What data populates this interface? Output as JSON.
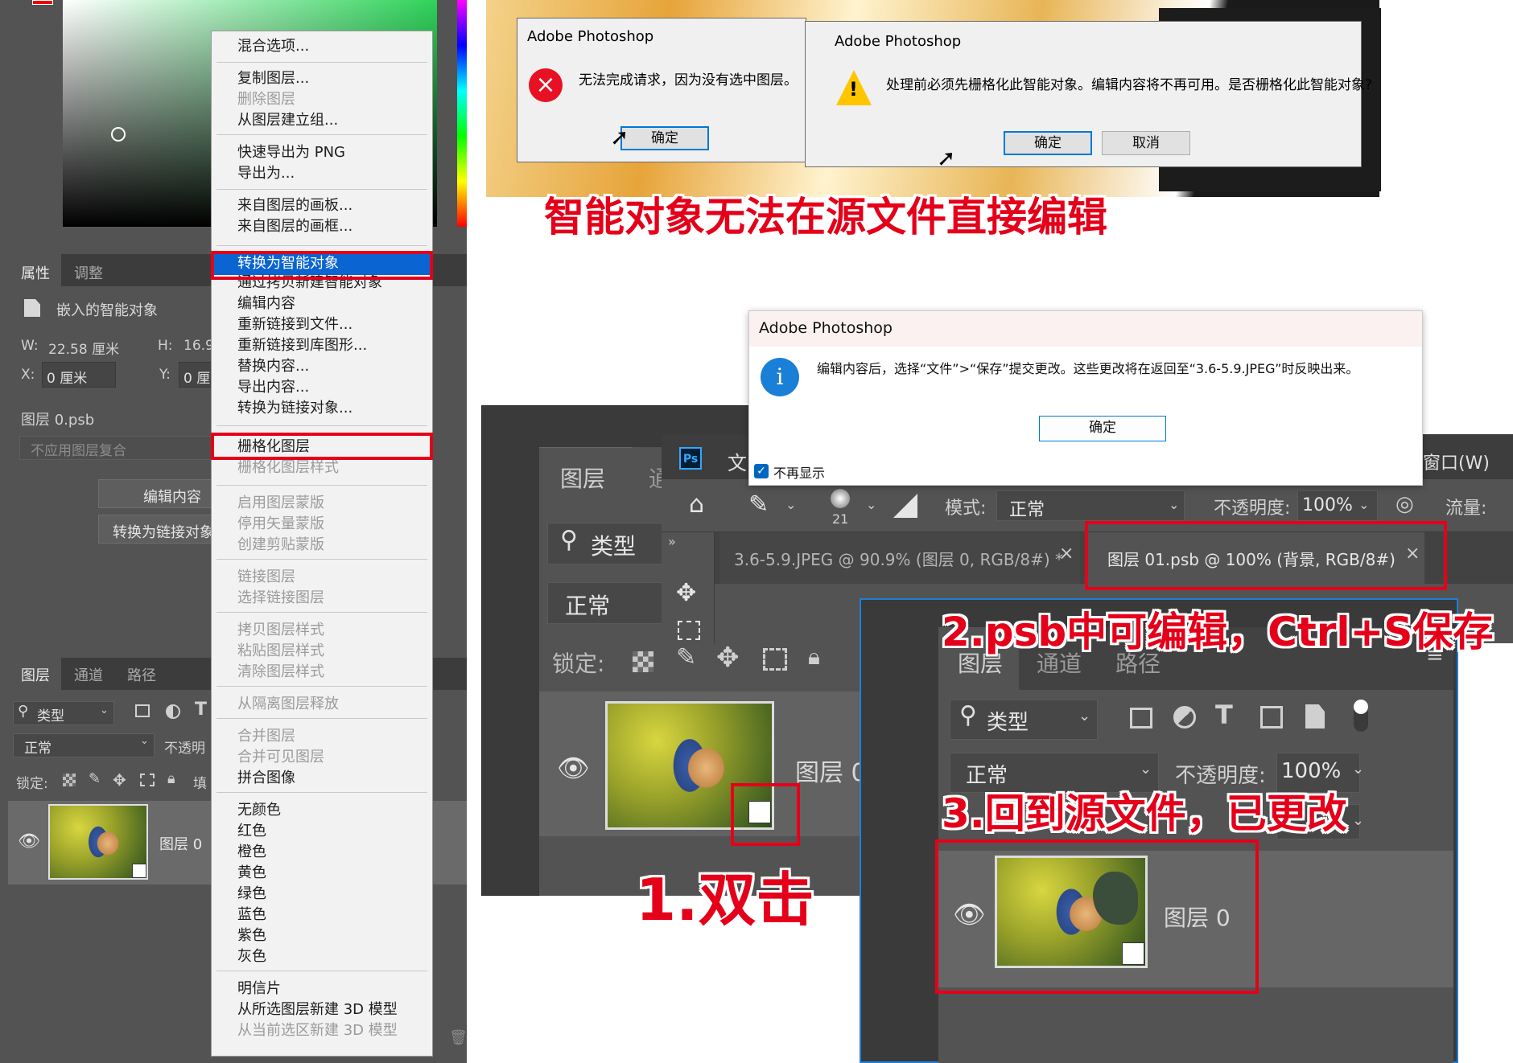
{
  "left_panel": {
    "properties_tabs": [
      "属性",
      "调整"
    ],
    "object_kind": "嵌入的智能对象",
    "w_label": "W:",
    "w_value": "22.58 厘米",
    "h_label": "H:",
    "h_value": "16.9",
    "x_label": "X:",
    "x_value": "0 厘米",
    "y_label": "Y:",
    "y_value": "0 厘",
    "file_name": "图层 0.psb",
    "layer_comp": "不应用图层复合",
    "edit_button": "编辑内容",
    "convert_button": "转换为链接对象",
    "layers_tabs": [
      "图层",
      "通道",
      "路径"
    ],
    "kind_filter": "类型",
    "blend_mode": "正常",
    "opacity_label": "不透明",
    "lock_label": "锁定:",
    "fill_label": "填",
    "layer_name": "图层 0"
  },
  "context_menu": {
    "items": [
      {
        "label": "混合选项...",
        "disabled": false
      },
      {
        "label": "复制图层...",
        "disabled": false
      },
      {
        "label": "删除图层",
        "disabled": true
      },
      {
        "label": "从图层建立组...",
        "disabled": false
      },
      {
        "label": "快速导出为 PNG",
        "disabled": false
      },
      {
        "label": "导出为...",
        "disabled": false
      },
      {
        "label": "来自图层的画板...",
        "disabled": false
      },
      {
        "label": "来自图层的画框...",
        "disabled": false
      },
      {
        "label": "转换为智能对象",
        "disabled": false,
        "highlighted": true
      },
      {
        "label": "通过拷贝新建智能对象",
        "disabled": false
      },
      {
        "label": "编辑内容",
        "disabled": false
      },
      {
        "label": "重新链接到文件...",
        "disabled": false
      },
      {
        "label": "重新链接到库图形...",
        "disabled": false
      },
      {
        "label": "替换内容...",
        "disabled": false
      },
      {
        "label": "导出内容...",
        "disabled": false
      },
      {
        "label": "转换为链接对象...",
        "disabled": false
      },
      {
        "label": "栅格化图层",
        "disabled": false
      },
      {
        "label": "栅格化图层样式",
        "disabled": true
      },
      {
        "label": "启用图层蒙版",
        "disabled": true
      },
      {
        "label": "停用矢量蒙版",
        "disabled": true
      },
      {
        "label": "创建剪贴蒙版",
        "disabled": true
      },
      {
        "label": "链接图层",
        "disabled": true
      },
      {
        "label": "选择链接图层",
        "disabled": true
      },
      {
        "label": "拷贝图层样式",
        "disabled": true
      },
      {
        "label": "粘贴图层样式",
        "disabled": true
      },
      {
        "label": "清除图层样式",
        "disabled": true
      },
      {
        "label": "从隔离图层释放",
        "disabled": true
      },
      {
        "label": "合并图层",
        "disabled": true
      },
      {
        "label": "合并可见图层",
        "disabled": true
      },
      {
        "label": "拼合图像",
        "disabled": false
      },
      {
        "label": "无颜色",
        "disabled": false
      },
      {
        "label": "红色",
        "disabled": false
      },
      {
        "label": "橙色",
        "disabled": false
      },
      {
        "label": "黄色",
        "disabled": false
      },
      {
        "label": "绿色",
        "disabled": false
      },
      {
        "label": "蓝色",
        "disabled": false
      },
      {
        "label": "紫色",
        "disabled": false
      },
      {
        "label": "灰色",
        "disabled": false
      },
      {
        "label": "明信片",
        "disabled": false
      },
      {
        "label": "从所选图层新建 3D 模型",
        "disabled": false
      },
      {
        "label": "从当前选区新建 3D 模型",
        "disabled": true
      }
    ]
  },
  "dialog1": {
    "title": "Adobe Photoshop",
    "message": "无法完成请求，因为没有选中图层。",
    "ok": "确定"
  },
  "dialog2": {
    "title": "Adobe Photoshop",
    "message": "处理前必须先栅格化此智能对象。编辑内容将不再可用。是否栅格化此智能对象?",
    "ok": "确定",
    "cancel": "取消"
  },
  "dialog3": {
    "title": "Adobe Photoshop",
    "message": "编辑内容后，选择“文件”>“保存”提交更改。这些更改将在返回至“3.6-5.9.JPEG”时反映出来。",
    "ok": "确定",
    "checkbox": "不再显示"
  },
  "annotations": {
    "a0": "智能对象无法在源文件直接编辑",
    "a1": "1.双击",
    "a2": "2.psb中可编辑，Ctrl+S保存",
    "a3": "3.回到源文件，已更改"
  },
  "mid_panel": {
    "tabs": [
      "图层",
      "通"
    ],
    "kind_filter": "类型",
    "blend_mode": "正常",
    "lock_label": "锁定:",
    "layer_name": "图层 0"
  },
  "psb_window": {
    "menu_partial": "文",
    "menu_window": "窗口(W)",
    "brush_size": "21",
    "mode_label": "模式:",
    "mode_value": "正常",
    "opacity_label": "不透明度:",
    "opacity_value": "100%",
    "flow_label": "流量:",
    "tab1": "3.6-5.9.JPEG @ 90.9% (图层 0, RGB/8#) *",
    "tab2": "图层 01.psb @ 100% (背景, RGB/8#)",
    "close": "×"
  },
  "right_panel": {
    "tabs": [
      "图层",
      "通道",
      "路径"
    ],
    "kind_filter": "类型",
    "blend_mode": "正常",
    "opacity_label": "不透明度:",
    "opacity_value": "100%",
    "layer_name": "图层 0"
  }
}
